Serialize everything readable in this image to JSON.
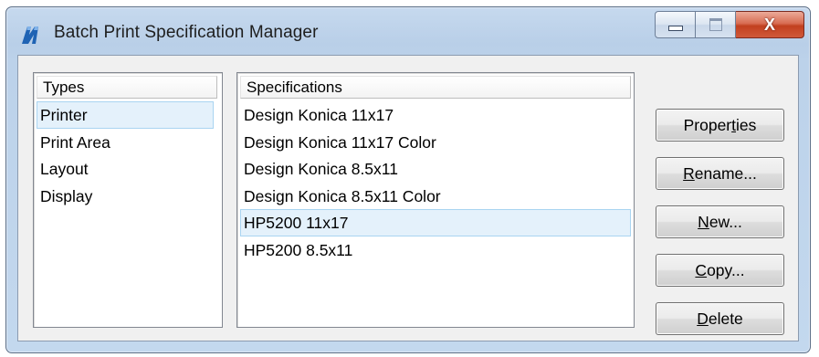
{
  "window": {
    "title": "Batch Print Specification Manager",
    "controls": {
      "minimize": "minimize",
      "maximize": "maximize",
      "close": "X"
    }
  },
  "types": {
    "header": "Types",
    "items": [
      "Printer",
      "Print Area",
      "Layout",
      "Display"
    ],
    "selected_index": 0
  },
  "specifications": {
    "header": "Specifications",
    "items": [
      "Design Konica 11x17",
      "Design Konica 11x17 Color",
      "Design Konica 8.5x11",
      "Design Konica 8.5x11 Color",
      "HP5200 11x17",
      "HP5200 8.5x11"
    ],
    "selected_index": 4
  },
  "buttons": {
    "properties": {
      "pre": "Proper",
      "mnemonic": "t",
      "post": "ies"
    },
    "rename": {
      "pre": "",
      "mnemonic": "R",
      "post": "ename..."
    },
    "new": {
      "pre": "",
      "mnemonic": "N",
      "post": "ew..."
    },
    "copy": {
      "pre": "",
      "mnemonic": "C",
      "post": "opy..."
    },
    "delete": {
      "pre": "",
      "mnemonic": "D",
      "post": "elete"
    }
  },
  "colors": {
    "selection_bg": "#e4f1fb",
    "selection_border": "#a9d4f1",
    "close_button": "#c2401f",
    "frame": "#bcd2ea"
  }
}
